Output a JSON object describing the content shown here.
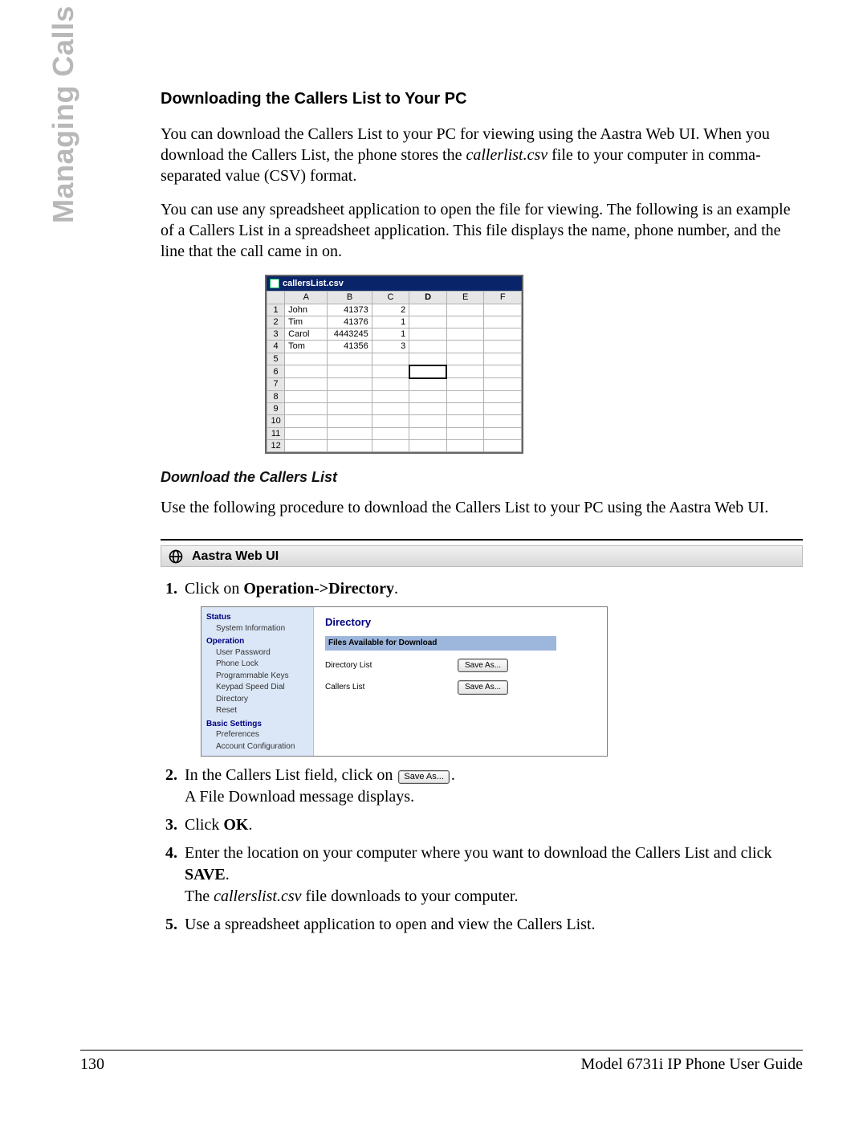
{
  "side_label": "Managing Calls",
  "section_title": "Downloading the Callers List to Your PC",
  "para1_a": "You can download the Callers List to your PC for viewing using the Aastra Web UI. When you download the Callers List, the phone stores the ",
  "para1_file": "callerlist.csv",
  "para1_b": " file to your computer in comma-separated value (CSV) format.",
  "para2": "You can use any spreadsheet application to open the file for viewing. The following is an example of a Callers List in a spreadsheet application. This file displays the name, phone number, and the line that the call came in on.",
  "spreadsheet": {
    "title": "callersList.csv",
    "columns": [
      "A",
      "B",
      "C",
      "D",
      "E",
      "F"
    ],
    "rows": [
      {
        "n": "1",
        "A": "John",
        "B": "41373",
        "C": "2"
      },
      {
        "n": "2",
        "A": "Tim",
        "B": "41376",
        "C": "1"
      },
      {
        "n": "3",
        "A": "Carol",
        "B": "4443245",
        "C": "1"
      },
      {
        "n": "4",
        "A": "Tom",
        "B": "41356",
        "C": "3"
      },
      {
        "n": "5"
      },
      {
        "n": "6",
        "selD": true
      },
      {
        "n": "7"
      },
      {
        "n": "8"
      },
      {
        "n": "9"
      },
      {
        "n": "10"
      },
      {
        "n": "11"
      },
      {
        "n": "12"
      }
    ]
  },
  "subsection_title": "Download the Callers List",
  "para3": "Use the following procedure to download the Callers List to your PC using the Aastra Web UI.",
  "webui_label": "Aastra Web UI",
  "step1_a": "Click on ",
  "step1_b": "Operation->Directory",
  "step1_c": ".",
  "aastra": {
    "groups": [
      {
        "label": "Status",
        "items": [
          "System Information"
        ]
      },
      {
        "label": "Operation",
        "items": [
          "User Password",
          "Phone Lock",
          "Programmable Keys",
          "Keypad Speed Dial",
          "Directory",
          "Reset"
        ]
      },
      {
        "label": "Basic Settings",
        "items": [
          "Preferences",
          "Account Configuration"
        ]
      }
    ],
    "heading": "Directory",
    "band": "Files Available for Download",
    "rows": [
      {
        "label": "Directory List",
        "button": "Save As..."
      },
      {
        "label": "Callers List",
        "button": "Save As..."
      }
    ]
  },
  "step2_a": "In the Callers List field, click on ",
  "step2_btn": "Save As...",
  "step2_b": ".",
  "step2_c": "A File Download message displays.",
  "step3_a": "Click ",
  "step3_b": "OK",
  "step3_c": ".",
  "step4_a": "Enter the location on your computer where you want to download the Callers List and click ",
  "step4_b": "SAVE",
  "step4_c": ".",
  "step4_d_a": "The ",
  "step4_d_file": "callerslist.csv",
  "step4_d_b": " file downloads to your computer.",
  "step5": "Use a spreadsheet application to open and view the Callers List.",
  "footer_left": "130",
  "footer_right": "Model 6731i IP Phone User Guide"
}
